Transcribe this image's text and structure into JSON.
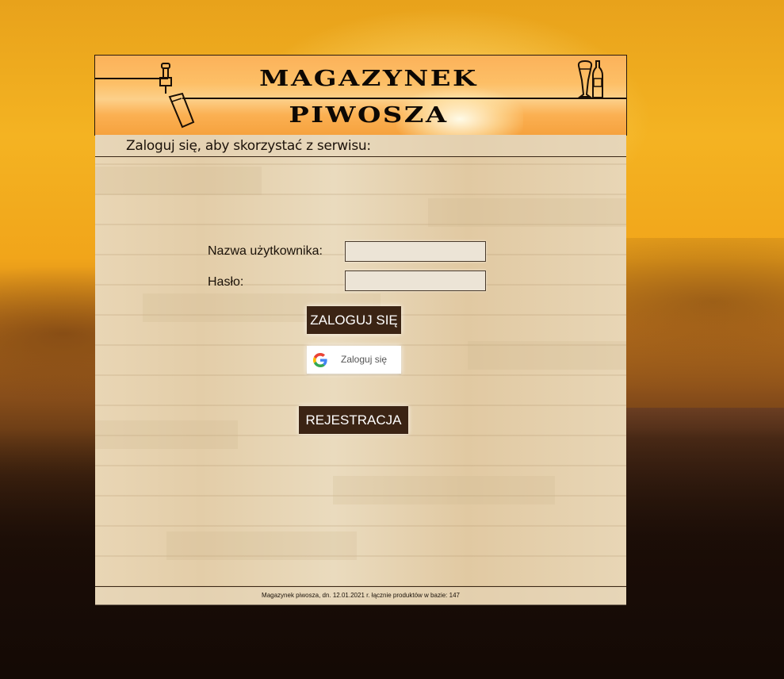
{
  "header": {
    "title_line1": "MAGAZYNEK",
    "title_line2": "PIWOSZA",
    "tap_icon": "beer-tap-icon",
    "glasses_icon": "beer-glass-and-bottle-icon"
  },
  "subheader": {
    "text": "Zaloguj się, aby skorzystać z serwisu:"
  },
  "login_form": {
    "username_label": "Nazwa użytkownika:",
    "username_value": "",
    "password_label": "Hasło:",
    "password_value": "",
    "login_button": "ZALOGUJ SIĘ",
    "google_button": "Zaloguj się",
    "google_icon": "google-g-icon",
    "register_button": "REJESTRACJA"
  },
  "footer": {
    "text": "Magazynek piwosza, dn. 12.01.2021 r. łącznie produktów w bazie: 147"
  },
  "colors": {
    "button_dark": "#3b2414",
    "header_orange": "#fbb25a",
    "background_sunset": "#f1a51a"
  }
}
